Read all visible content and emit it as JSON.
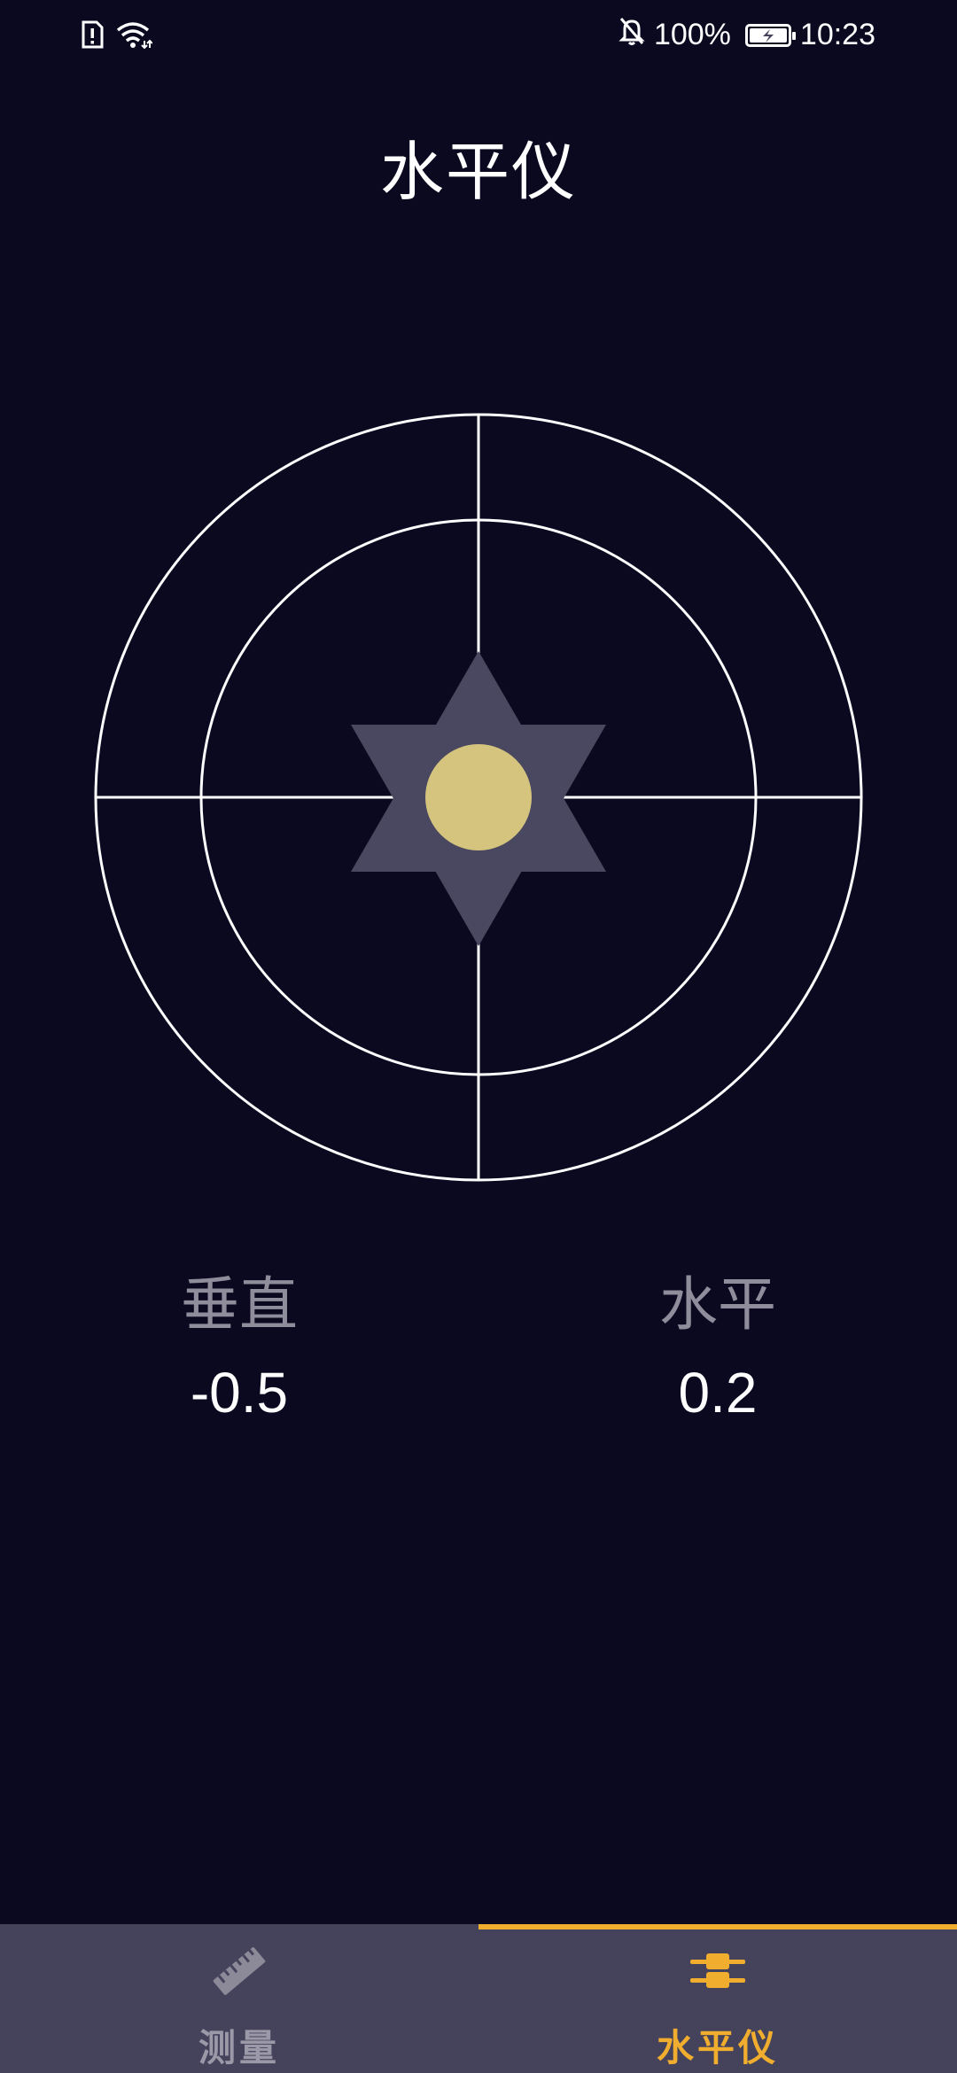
{
  "status_bar": {
    "battery_percent": "100%",
    "time": "10:23"
  },
  "header": {
    "title": "水平仪"
  },
  "readouts": {
    "vertical": {
      "label": "垂直",
      "value": "-0.5"
    },
    "horizontal": {
      "label": "水平",
      "value": "0.2"
    }
  },
  "bottom_nav": {
    "tabs": [
      {
        "label": "测量",
        "icon": "ruler-icon",
        "active": false
      },
      {
        "label": "水平仪",
        "icon": "level-icon",
        "active": true
      }
    ]
  },
  "colors": {
    "background": "#0b0920",
    "accent": "#f0ad2e",
    "bubble": "#d4c47e",
    "star": "#4a4760",
    "nav_background": "#45425c"
  },
  "icons": {
    "sim": "sim-alert-icon",
    "wifi": "wifi-icon",
    "mute": "bell-off-icon",
    "battery": "battery-charging-icon"
  }
}
